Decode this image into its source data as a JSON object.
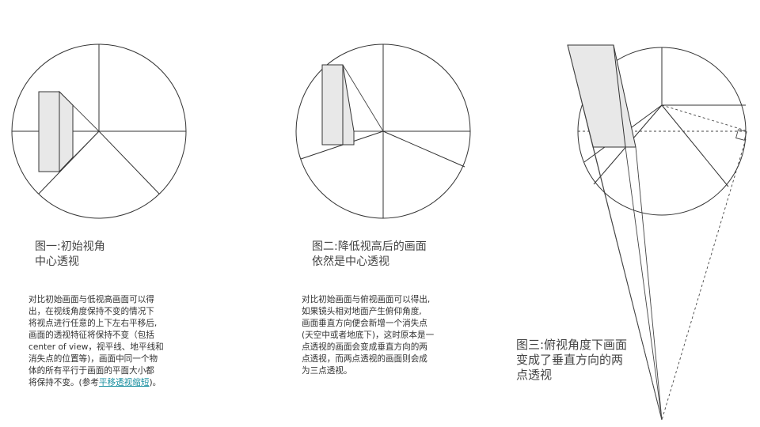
{
  "figure1": {
    "caption_line1": "图一:初始视角",
    "caption_line2": "中心透视",
    "para_lines": [
      "对比初始画面与低视高画面可以得",
      "出，在视线角度保持不变的情况下",
      "将视点进行任意的上下左右平移后,",
      "画面的透视特征将保持不变（包括",
      "center of view，视平线、地平线和",
      "消失点的位置等)，画面中同一个物",
      "体的所有平行于画面的平面大小都"
    ],
    "para_last_prefix": "将保持不变。(参考",
    "para_link": "平移透视缩短",
    "para_last_suffix": ")。"
  },
  "figure2": {
    "caption_line1": "图二:降低视高后的画面",
    "caption_line2": "依然是中心透视",
    "para_lines": [
      "对比初始画面与俯视画面可以得出,",
      "如果镜头相对地面产生俯仰角度,",
      "画面垂直方向便会新增一个消失点",
      "(天空中或者地底下)，这时原本是一",
      "点透视的画面会变成垂直方向的两",
      "点透视，而两点透视的画面则会成",
      "为三点透视。"
    ]
  },
  "figure3": {
    "caption_lines": [
      "图三:俯视角度下画面",
      "变成了垂直方向的两",
      "点透视"
    ]
  },
  "colors": {
    "line": "#333333",
    "box_fill": "#e8e8e8",
    "link": "#1a8fa0"
  }
}
